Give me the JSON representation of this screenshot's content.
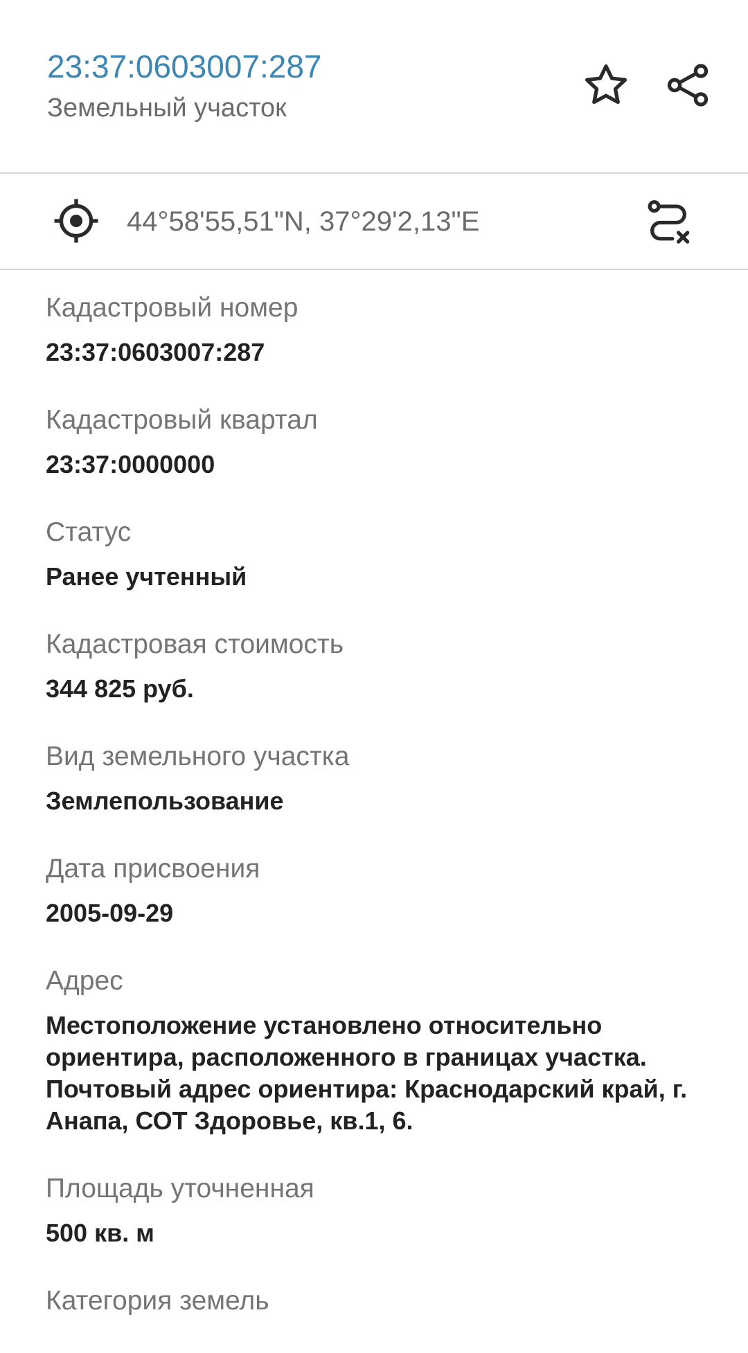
{
  "header": {
    "title": "23:37:0603007:287",
    "subtitle": "Земельный участок",
    "favorite_icon": "star-icon",
    "share_icon": "share-icon"
  },
  "coords": {
    "locate_icon": "crosshair-icon",
    "text": "44°58'55,51\"N, 37°29'2,13\"E",
    "route_icon": "route-clear-icon"
  },
  "properties": [
    {
      "label": "Кадастровый номер",
      "value": "23:37:0603007:287"
    },
    {
      "label": "Кадастровый квартал",
      "value": "23:37:0000000"
    },
    {
      "label": "Статус",
      "value": "Ранее учтенный"
    },
    {
      "label": "Кадастровая стоимость",
      "value": "344 825 руб."
    },
    {
      "label": "Вид земельного участка",
      "value": "Землепользование"
    },
    {
      "label": "Дата присвоения",
      "value": "2005-09-29"
    },
    {
      "label": "Адрес",
      "value": "Местоположение установлено относительно ориентира, расположенного в границах участка. Почтовый адрес ориентира: Краснодарский край, г. Анапа, СОТ Здоровье, кв.1, 6."
    },
    {
      "label": "Площадь уточненная",
      "value": "500 кв. м"
    },
    {
      "label": "Категория земель",
      "value": ""
    }
  ],
  "colors": {
    "accent": "#3b86b3",
    "label": "#757575",
    "value": "#222222",
    "divider": "#d6d6d6"
  }
}
